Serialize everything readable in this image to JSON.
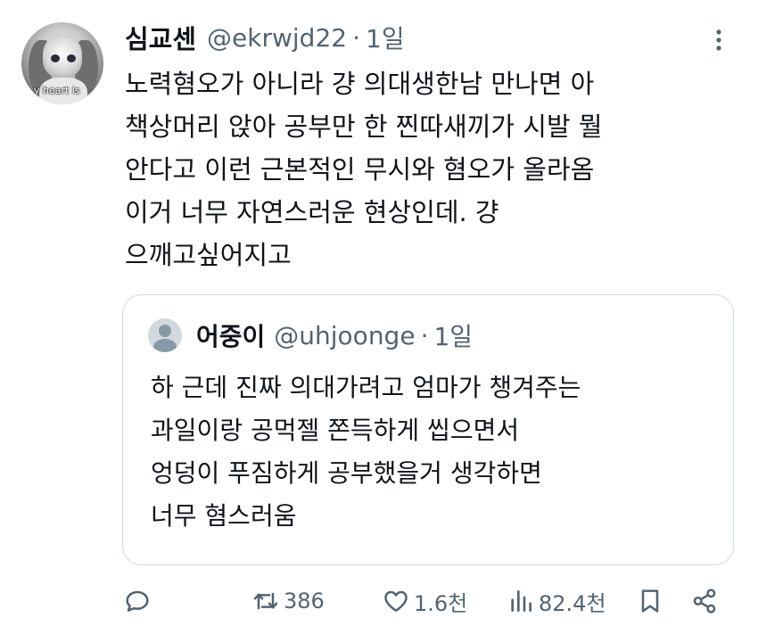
{
  "author": {
    "display_name": "심교센",
    "handle": "@ekrwjd22",
    "separator": "·",
    "time": "1일",
    "avatar_caption": "y heart is"
  },
  "tweet": {
    "lines": [
      "노력혐오가 아니라 걍 의대생한남 만나면 아",
      "책상머리 앉아 공부만 한 찐따새끼가 시발 뭘",
      "안다고 이런 근본적인 무시와 혐오가 올라옴",
      "이거 너무 자연스러운 현상인데. 걍",
      "으깨고싶어지고"
    ]
  },
  "quoted": {
    "display_name": "어중이",
    "handle": "@uhjoonge",
    "separator": "·",
    "time": "1일",
    "lines": [
      "하 근데 진짜 의대가려고 엄마가 챙겨주는",
      "과일이랑 공먹젤 쫀득하게 씹으면서",
      "엉덩이 푸짐하게 공부했을거 생각하면",
      "너무 혐스러움"
    ]
  },
  "actions": {
    "reply": {
      "icon": "reply-icon",
      "count": ""
    },
    "retweet": {
      "icon": "retweet-icon",
      "count": "386"
    },
    "like": {
      "icon": "heart-icon",
      "count": "1.6천"
    },
    "views": {
      "icon": "views-icon",
      "count": "82.4천"
    },
    "bookmark": {
      "icon": "bookmark-icon"
    },
    "share": {
      "icon": "share-icon"
    }
  },
  "colors": {
    "text": "#0f1419",
    "secondary": "#536471",
    "border": "#cfd9de",
    "background": "#ffffff"
  }
}
